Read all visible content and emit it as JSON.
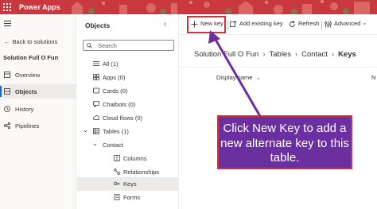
{
  "header": {
    "app_title": "Power Apps",
    "bar_color": "#c8383e"
  },
  "leftnav": {
    "back_label": "Back to solutions",
    "solution_name": "Solution Full O Fun",
    "items": [
      {
        "label": "Overview",
        "icon": "overview-icon"
      },
      {
        "label": "Objects",
        "icon": "objects-icon",
        "active": true
      },
      {
        "label": "History",
        "icon": "history-icon"
      },
      {
        "label": "Pipelines",
        "icon": "pipelines-icon"
      }
    ]
  },
  "objects": {
    "title": "Objects",
    "search_placeholder": "Search",
    "tree": [
      {
        "label": "All  (1)",
        "icon": "list-icon"
      },
      {
        "label": "Apps  (0)",
        "icon": "apps-icon"
      },
      {
        "label": "Cards  (0)",
        "icon": "cards-icon"
      },
      {
        "label": "Chatbots  (0)",
        "icon": "chatbot-icon"
      },
      {
        "label": "Cloud flows  (0)",
        "icon": "cloud-flow-icon"
      },
      {
        "label": "Tables  (1)",
        "icon": "table-icon"
      },
      {
        "label": "Contact",
        "icon": "chevron-down-icon"
      },
      {
        "label": "Columns",
        "icon": "columns-icon"
      },
      {
        "label": "Relationships",
        "icon": "relationships-icon"
      },
      {
        "label": "Keys",
        "icon": "key-icon",
        "selected": true
      },
      {
        "label": "Forms",
        "icon": "forms-icon"
      }
    ]
  },
  "cmdbar": {
    "new_key": "New key",
    "add_existing_key": "Add existing key",
    "refresh": "Refresh",
    "advanced": "Advanced"
  },
  "breadcrumb": {
    "items": [
      "Solution Full O Fun",
      "Tables",
      "Contact"
    ],
    "current": "Keys"
  },
  "grid": {
    "column_display_name": "Display name",
    "column_2": "N"
  },
  "callout": {
    "text": "Click New Key to add a new alternate key to this table.",
    "background": "#6b2fa0",
    "border": "#d13438"
  },
  "colors": {
    "accent": "#0f6cbd",
    "highlight_border": "#d13438"
  }
}
